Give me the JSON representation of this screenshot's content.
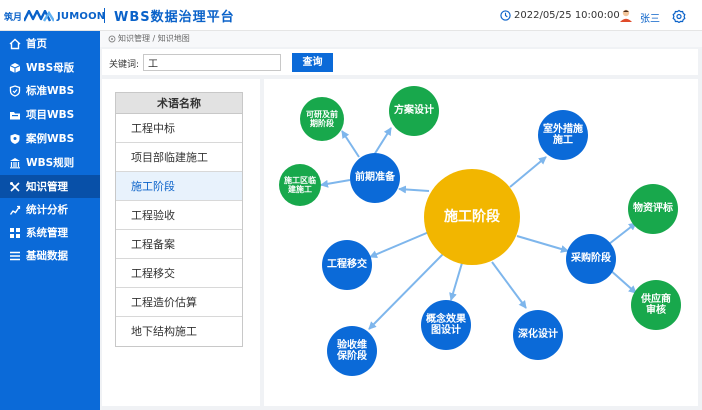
{
  "header": {
    "logo_cn": "筑月",
    "logo_en": "JUMOON",
    "title": "WBS数据治理平台",
    "datetime": "2022/05/25  10:00:00",
    "user": "张三"
  },
  "sidebar": {
    "items": [
      {
        "label": "首页",
        "icon": "home-icon"
      },
      {
        "label": "WBS母版",
        "icon": "cube-icon"
      },
      {
        "label": "标准WBS",
        "icon": "shield-icon"
      },
      {
        "label": "项目WBS",
        "icon": "folder-icon"
      },
      {
        "label": "案例WBS",
        "icon": "case-shield-icon"
      },
      {
        "label": "WBS规则",
        "icon": "building-icon"
      },
      {
        "label": "知识管理",
        "icon": "tools-icon",
        "active": true
      },
      {
        "label": "统计分析",
        "icon": "chart-icon"
      },
      {
        "label": "系统管理",
        "icon": "grid-icon"
      },
      {
        "label": "基础数据",
        "icon": "list-icon"
      }
    ]
  },
  "breadcrumb": "知识管理 / 知识地图",
  "search": {
    "label": "关键词:",
    "value": "工",
    "button": "查询"
  },
  "term_list": {
    "header": "术语名称",
    "items": [
      "工程中标",
      "项目部临建施工",
      "施工阶段",
      "工程验收",
      "工程备案",
      "工程移交",
      "工程造价估算",
      "地下结构施工"
    ],
    "selected": "施工阶段"
  },
  "knowledge_map": {
    "center": "施工阶段",
    "nodes": [
      {
        "label": "可研及前期阶段",
        "color": "green"
      },
      {
        "label": "方案设计",
        "color": "green"
      },
      {
        "label": "前期准备",
        "color": "blue"
      },
      {
        "label": "施工区临建施工",
        "color": "green"
      },
      {
        "label": "室外措施施工",
        "color": "blue"
      },
      {
        "label": "物资评标",
        "color": "green"
      },
      {
        "label": "采购阶段",
        "color": "blue"
      },
      {
        "label": "供应商审核",
        "color": "green"
      },
      {
        "label": "工程移交",
        "color": "blue"
      },
      {
        "label": "概念效果图设计",
        "color": "blue"
      },
      {
        "label": "深化设计",
        "color": "blue"
      },
      {
        "label": "验收维保阶段",
        "color": "blue"
      }
    ]
  },
  "colors": {
    "primary": "#0b6ad8",
    "active_nav": "#0850a8",
    "center_node": "#f2b600",
    "green_node": "#18a84c",
    "link": "#7eb6ec"
  }
}
